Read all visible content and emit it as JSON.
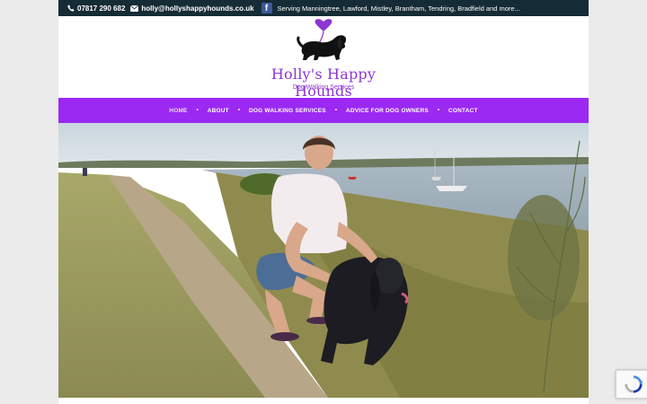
{
  "topbar": {
    "phone": "07817 290 682",
    "email": "holly@hollyshappyhounds.co.uk",
    "facebook_icon": "facebook-icon",
    "serving": "Serving Manningtree, Lawford, Mistley, Brantham, Tendring, Bradfield and more..."
  },
  "logo": {
    "title": "Holly's Happy Hounds",
    "subtitle": "Dog Walking Services"
  },
  "nav": {
    "items": [
      {
        "label": "HOME"
      },
      {
        "label": "ABOUT"
      },
      {
        "label": "DOG WALKING SERVICES"
      },
      {
        "label": "ADVICE FOR DOG OWNERS"
      },
      {
        "label": "CONTACT"
      }
    ],
    "separator": "•"
  },
  "colors": {
    "topbar": "#152b35",
    "nav": "#9b29f2",
    "brand_purple": "#8c35d3",
    "page_bg": "#ebebeb"
  },
  "hero": {
    "image": "woman-with-spaniel-by-estuary-photo"
  },
  "recaptcha": {
    "icon": "recaptcha-icon"
  }
}
